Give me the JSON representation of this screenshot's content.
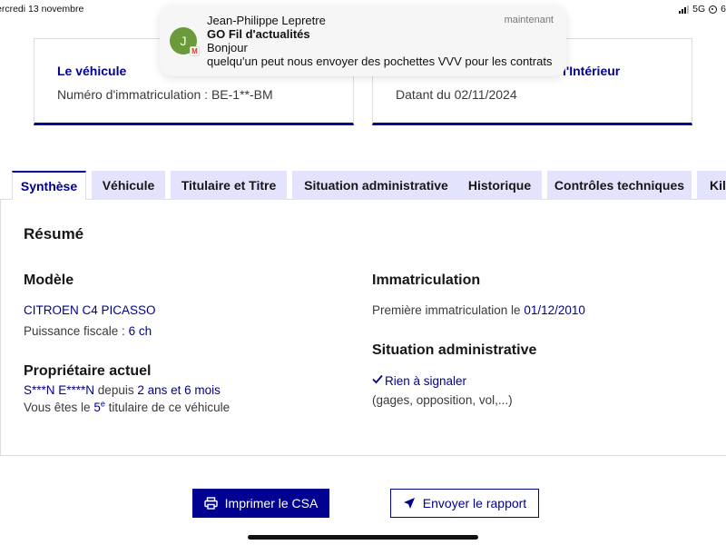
{
  "status_bar": {
    "date": "ercredi 13 novembre",
    "network": "5G",
    "battery_partial": "6"
  },
  "notification": {
    "avatar_letter": "J",
    "sender": "Jean-Philippe Lepretre",
    "time": "maintenant",
    "title": "GO Fil d'actualités",
    "line1": "Bonjour",
    "line2": "quelqu'un  peut nous envoyer des pochettes VVV pour les contrats..."
  },
  "cards": {
    "vehicle": {
      "title": "Le véhicule",
      "text": "Numéro d'immatriculation : BE-1**-BM"
    },
    "ministry": {
      "title_partial": "l'Intérieur",
      "text": "Datant du 02/11/2024"
    }
  },
  "tabs": [
    {
      "label": "Synthèse",
      "active": true
    },
    {
      "label": "Véhicule",
      "active": false
    },
    {
      "label": "Titulaire et Titre",
      "active": false
    },
    {
      "label": "Situation administrative",
      "active": false
    },
    {
      "label": "Historique",
      "active": false
    },
    {
      "label": "Contrôles techniques",
      "active": false
    },
    {
      "label": "Kilo",
      "active": false
    }
  ],
  "summary": {
    "heading": "Résumé",
    "model": {
      "heading": "Modèle",
      "name": "CITROEN C4 PICASSO",
      "power_label": "Puissance fiscale : ",
      "power_value": "6 ch"
    },
    "owner": {
      "heading": "Propriétaire actuel",
      "name": "S***N E****N",
      "since_label": " depuis ",
      "since_value": "2 ans et 6 mois",
      "rank_prefix": "Vous êtes le ",
      "rank_number": "5",
      "rank_sup": "e",
      "rank_suffix": " titulaire de ce véhicule"
    },
    "registration": {
      "heading": "Immatriculation",
      "first_label": "Première immatriculation le ",
      "first_date": "01/12/2010"
    },
    "admin": {
      "heading": "Situation administrative",
      "status": "Rien à signaler",
      "detail": "(gages, opposition, vol,...)"
    }
  },
  "actions": {
    "print": "Imprimer le CSA",
    "send": "Envoyer le rapport"
  }
}
